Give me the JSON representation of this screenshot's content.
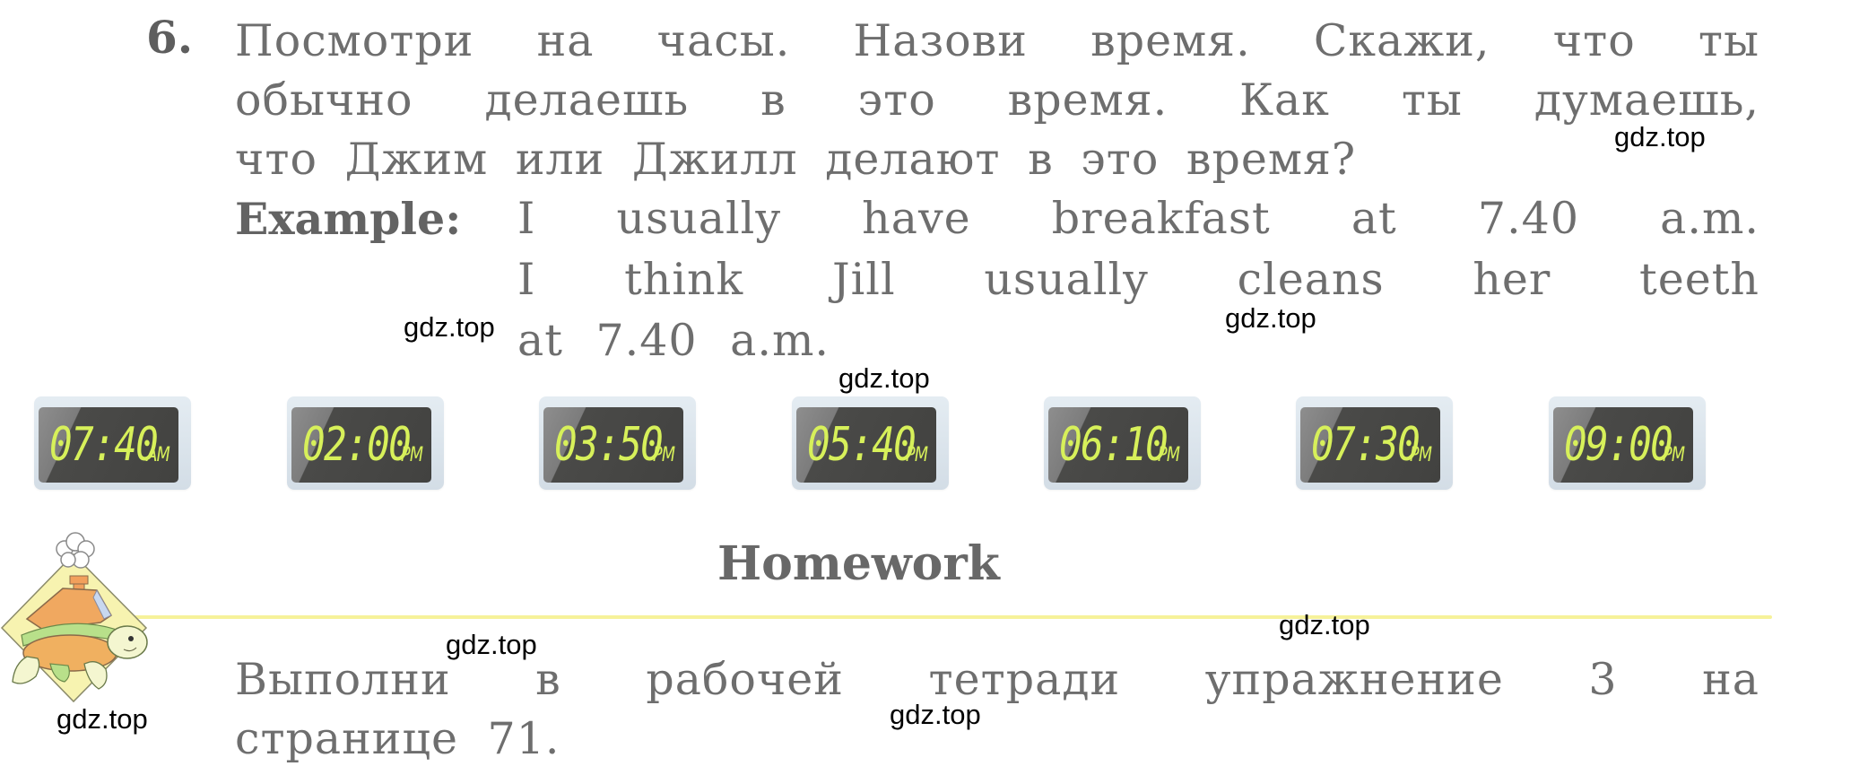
{
  "exercise": {
    "number": "6.",
    "instruction_lines": [
      "Посмотри на часы. Назови время. Скажи, что ты",
      "обычно делаешь в это время. Как ты думаешь,",
      "что Джим или Джилл делают в это время?"
    ],
    "example_label": "Example:",
    "example_lines": [
      "I usually have breakfast at 7.40 a.m.",
      "I think Jill usually cleans her teeth",
      "at 7.40 a.m."
    ]
  },
  "clocks": [
    {
      "time": "07:40",
      "period": "AM"
    },
    {
      "time": "02:00",
      "period": "PM"
    },
    {
      "time": "03:50",
      "period": "PM"
    },
    {
      "time": "05:40",
      "period": "PM"
    },
    {
      "time": "06:10",
      "period": "PM"
    },
    {
      "time": "07:30",
      "period": "PM"
    },
    {
      "time": "09:00",
      "period": "PM"
    }
  ],
  "homework": {
    "title": "Homework",
    "lines": [
      "Выполни в рабочей тетради упражнение 3 на",
      "странице 71."
    ],
    "mascot_icon": "turtle-house-icon"
  },
  "watermarks": [
    "gdz.top",
    "gdz.top",
    "gdz.top",
    "gdz.top",
    "gdz.top",
    "gdz.top",
    "gdz.top",
    "gdz.top"
  ],
  "colors": {
    "text": "#6e6e6e",
    "clock_digits": "#d7f05a",
    "clock_screen": "#424240",
    "divider": "#f6f29a"
  }
}
